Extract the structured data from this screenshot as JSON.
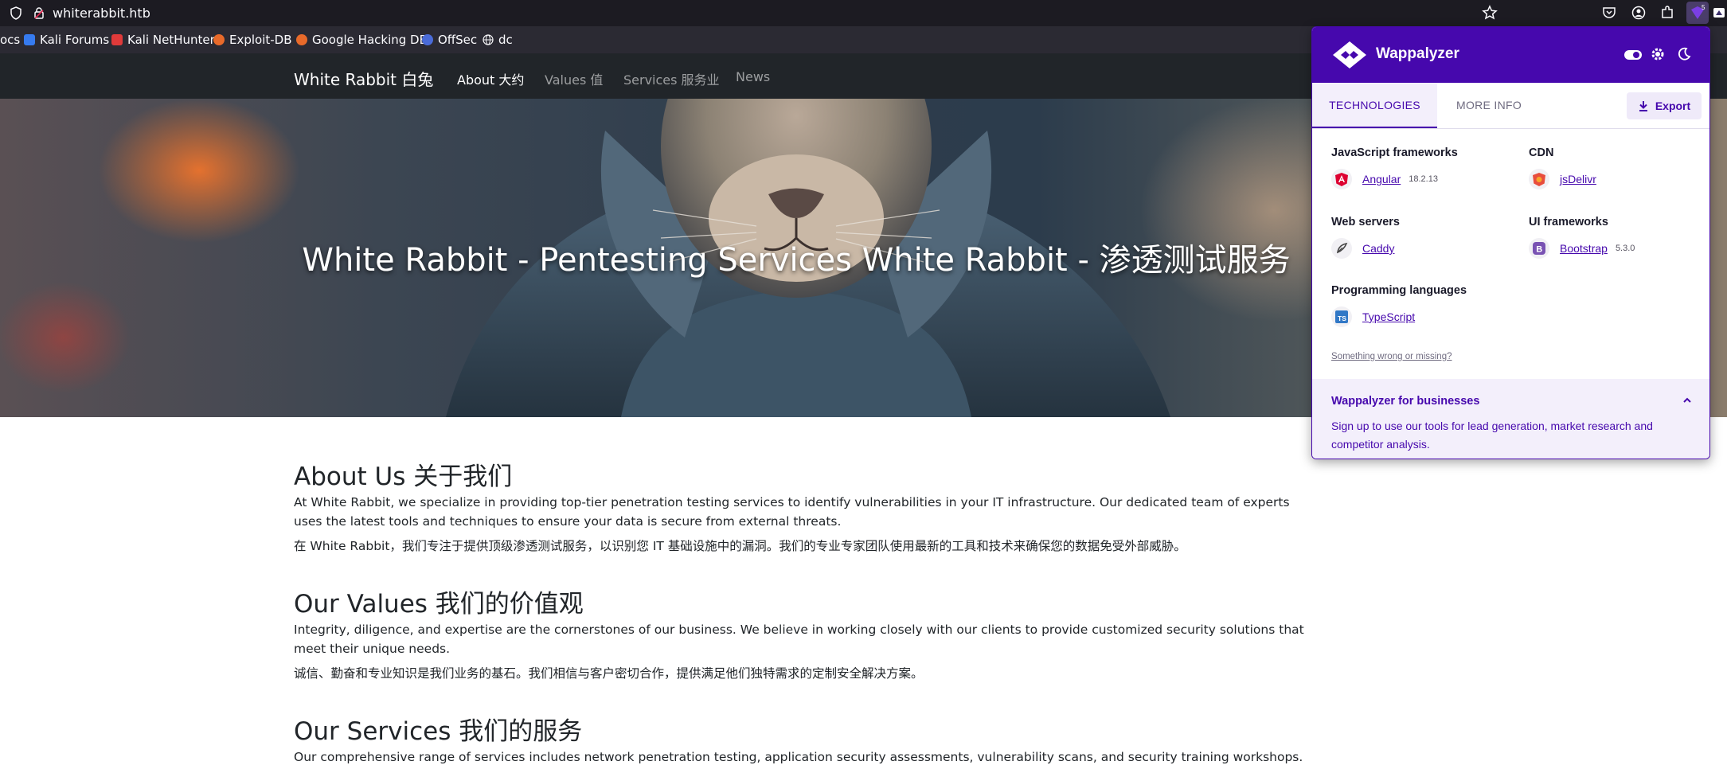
{
  "browser": {
    "url": "whiterabbit.htb",
    "bookmarks": [
      {
        "label": "ocs",
        "icon": "none",
        "color": ""
      },
      {
        "label": "Kali Forums",
        "icon": "kali-dragon-icon",
        "color": "#367bf0"
      },
      {
        "label": "Kali NetHunter",
        "icon": "nethunter-icon",
        "color": "#e03a3a"
      },
      {
        "label": "Exploit-DB",
        "icon": "exploit-db-icon",
        "color": "#e86a2a"
      },
      {
        "label": "Google Hacking DB",
        "icon": "ghdb-icon",
        "color": "#e86a2a"
      },
      {
        "label": "OffSec",
        "icon": "offsec-icon",
        "color": "#4a6bd8"
      },
      {
        "label": "dc",
        "icon": "globe-icon",
        "color": "#fbfbfe"
      }
    ],
    "extension_badge": "5"
  },
  "site": {
    "brand": "White Rabbit 白兔",
    "nav": [
      {
        "label": "About 大约",
        "active": true
      },
      {
        "label": "Values 值",
        "active": false
      },
      {
        "label": "Services 服务业",
        "active": false
      },
      {
        "label": "News",
        "active": false
      }
    ],
    "hero_title": "White Rabbit - Pentesting Services White Rabbit - 渗透测试服务",
    "sections": [
      {
        "heading": "About Us 关于我们",
        "en": "At White Rabbit, we specialize in providing top-tier penetration testing services to identify vulnerabilities in your IT infrastructure. Our dedicated team of experts uses the latest tools and techniques to ensure your data is secure from external threats.",
        "zh": "在 White Rabbit，我们专注于提供顶级渗透测试服务，以识别您 IT 基础设施中的漏洞。我们的专业专家团队使用最新的工具和技术来确保您的数据免受外部威胁。"
      },
      {
        "heading": "Our Values 我们的价值观",
        "en": "Integrity, diligence, and expertise are the cornerstones of our business. We believe in working closely with our clients to provide customized security solutions that meet their unique needs.",
        "zh": "诚信、勤奋和专业知识是我们业务的基石。我们相信与客户密切合作，提供满足他们独特需求的定制安全解决方案。"
      },
      {
        "heading": "Our Services 我们的服务",
        "en": "Our comprehensive range of services includes network penetration testing, application security assessments, vulnerability scans, and security training workshops."
      }
    ]
  },
  "wappalyzer": {
    "brand": "Wappalyzer",
    "tabs": [
      "TECHNOLOGIES",
      "MORE INFO"
    ],
    "export_label": "Export",
    "categories": [
      {
        "name": "JavaScript frameworks",
        "tech": "Angular",
        "version": "18.2.13",
        "icon": "angular-icon",
        "color": "#dd0031"
      },
      {
        "name": "CDN",
        "tech": "jsDelivr",
        "version": "",
        "icon": "jsdelivr-icon",
        "color": "#e84d3d"
      },
      {
        "name": "Web servers",
        "tech": "Caddy",
        "version": "",
        "icon": "caddy-icon",
        "color": "#444444"
      },
      {
        "name": "UI frameworks",
        "tech": "Bootstrap",
        "version": "5.3.0",
        "icon": "bootstrap-icon",
        "color": "#7952b3"
      },
      {
        "name": "Programming languages",
        "tech": "TypeScript",
        "version": "",
        "icon": "typescript-icon",
        "color": "#3178c6"
      }
    ],
    "wrong_link": "Something wrong or missing?",
    "biz_title": "Wappalyzer for businesses",
    "biz_text": "Sign up to use our tools for lead generation, market research and competitor analysis."
  }
}
